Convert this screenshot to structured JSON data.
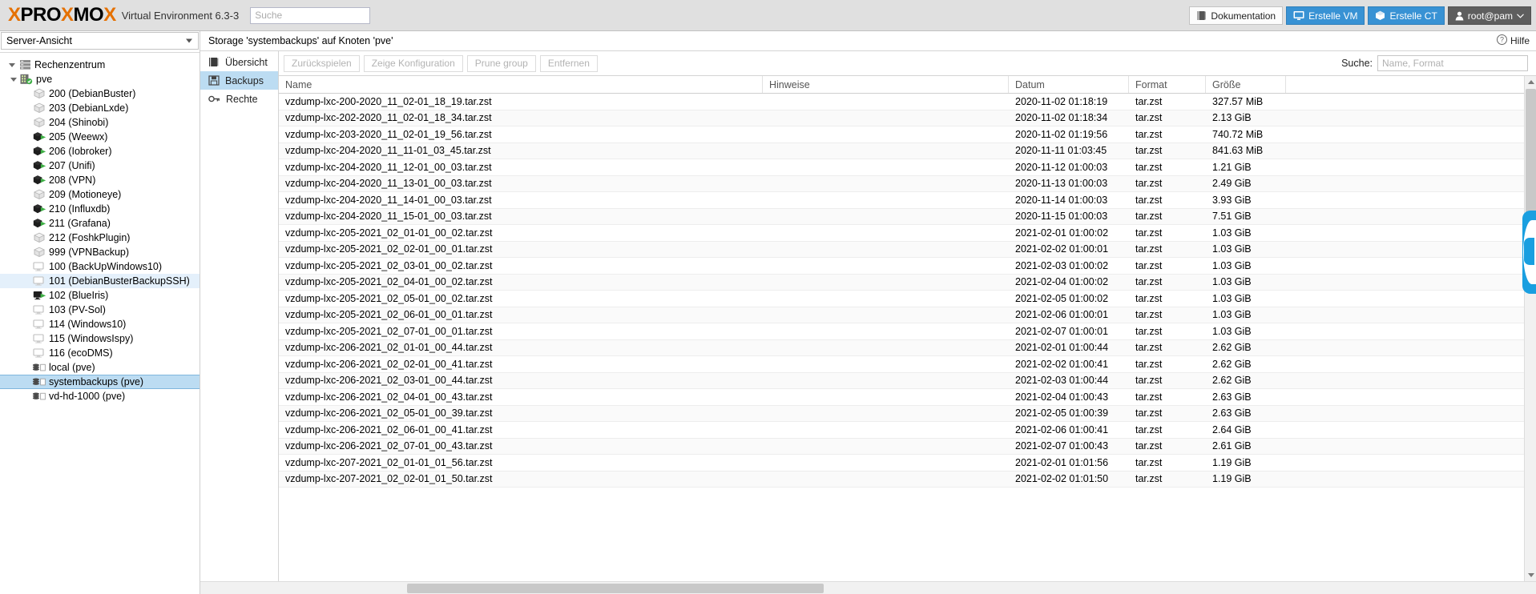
{
  "header": {
    "logo_x1": "X",
    "logo_pro": "PRO",
    "logo_x2": "X",
    "logo_mo": "MO",
    "logo_x3": "X",
    "product": "Virtual Environment 6.3-3",
    "search_placeholder": "Suche",
    "search_value": "",
    "documentation": "Dokumentation",
    "create_vm": "Erstelle VM",
    "create_ct": "Erstelle CT",
    "user": "root@pam"
  },
  "sidebar": {
    "view_selector": "Server-Ansicht",
    "items": [
      {
        "label": "Rechenzentrum",
        "icon": "datacenter-icon",
        "indent": 0,
        "expander": "expanded",
        "state": "none"
      },
      {
        "label": "pve",
        "icon": "node-icon",
        "indent": 1,
        "expander": "expanded",
        "state": "none"
      },
      {
        "label": "200 (DebianBuster)",
        "icon": "lxc-stopped-icon",
        "indent": 2,
        "expander": "none",
        "state": "stopped"
      },
      {
        "label": "203 (DebianLxde)",
        "icon": "lxc-stopped-icon",
        "indent": 2,
        "expander": "none",
        "state": "stopped"
      },
      {
        "label": "204 (Shinobi)",
        "icon": "lxc-stopped-icon",
        "indent": 2,
        "expander": "none",
        "state": "stopped"
      },
      {
        "label": "205 (Weewx)",
        "icon": "lxc-running-icon",
        "indent": 2,
        "expander": "none",
        "state": "running"
      },
      {
        "label": "206 (Iobroker)",
        "icon": "lxc-running-icon",
        "indent": 2,
        "expander": "none",
        "state": "running"
      },
      {
        "label": "207 (Unifi)",
        "icon": "lxc-running-icon",
        "indent": 2,
        "expander": "none",
        "state": "running"
      },
      {
        "label": "208 (VPN)",
        "icon": "lxc-running-icon",
        "indent": 2,
        "expander": "none",
        "state": "running"
      },
      {
        "label": "209 (Motioneye)",
        "icon": "lxc-stopped-icon",
        "indent": 2,
        "expander": "none",
        "state": "stopped"
      },
      {
        "label": "210 (Influxdb)",
        "icon": "lxc-running-icon",
        "indent": 2,
        "expander": "none",
        "state": "running"
      },
      {
        "label": "211 (Grafana)",
        "icon": "lxc-running-icon",
        "indent": 2,
        "expander": "none",
        "state": "running"
      },
      {
        "label": "212 (FoshkPlugin)",
        "icon": "lxc-stopped-icon",
        "indent": 2,
        "expander": "none",
        "state": "stopped"
      },
      {
        "label": "999 (VPNBackup)",
        "icon": "lxc-stopped-icon",
        "indent": 2,
        "expander": "none",
        "state": "stopped"
      },
      {
        "label": "100 (BackUpWindows10)",
        "icon": "qemu-stopped-icon",
        "indent": 2,
        "expander": "none",
        "state": "stopped"
      },
      {
        "label": "101 (DebianBusterBackupSSH)",
        "icon": "qemu-stopped-icon",
        "indent": 2,
        "expander": "none",
        "state": "stopped",
        "highlight": "hover"
      },
      {
        "label": "102 (BlueIris)",
        "icon": "qemu-running-icon",
        "indent": 2,
        "expander": "none",
        "state": "running"
      },
      {
        "label": "103 (PV-Sol)",
        "icon": "qemu-stopped-icon",
        "indent": 2,
        "expander": "none",
        "state": "stopped"
      },
      {
        "label": "114 (Windows10)",
        "icon": "qemu-stopped-icon",
        "indent": 2,
        "expander": "none",
        "state": "stopped"
      },
      {
        "label": "115 (WindowsIspy)",
        "icon": "qemu-stopped-icon",
        "indent": 2,
        "expander": "none",
        "state": "stopped"
      },
      {
        "label": "116 (ecoDMS)",
        "icon": "qemu-stopped-icon",
        "indent": 2,
        "expander": "none",
        "state": "stopped"
      },
      {
        "label": "local (pve)",
        "icon": "storage-icon",
        "indent": 2,
        "expander": "none",
        "state": "none"
      },
      {
        "label": "systembackups (pve)",
        "icon": "storage-icon",
        "indent": 2,
        "expander": "none",
        "state": "none",
        "highlight": "selected"
      },
      {
        "label": "vd-hd-1000 (pve)",
        "icon": "storage-icon",
        "indent": 2,
        "expander": "none",
        "state": "none"
      }
    ]
  },
  "content": {
    "title": "Storage 'systembackups' auf Knoten 'pve'",
    "help_label": "Hilfe",
    "tabs": [
      {
        "label": "Übersicht",
        "icon": "overview-icon",
        "active": false
      },
      {
        "label": "Backups",
        "icon": "floppy-icon",
        "active": true
      },
      {
        "label": "Rechte",
        "icon": "key-icon",
        "active": false
      }
    ],
    "toolbar": {
      "buttons": [
        {
          "label": "Zurückspielen",
          "disabled": true
        },
        {
          "label": "Zeige Konfiguration",
          "disabled": true
        },
        {
          "label": "Prune group",
          "disabled": true
        },
        {
          "label": "Entfernen",
          "disabled": true
        }
      ],
      "search_label": "Suche:",
      "search_placeholder": "Name, Format",
      "search_value": ""
    },
    "grid": {
      "columns": [
        "Name",
        "Hinweise",
        "Datum",
        "Format",
        "Größe"
      ],
      "rows": [
        {
          "name": "vzdump-lxc-200-2020_11_02-01_18_19.tar.zst",
          "note": "",
          "date": "2020-11-02 01:18:19",
          "format": "tar.zst",
          "size": "327.57 MiB"
        },
        {
          "name": "vzdump-lxc-202-2020_11_02-01_18_34.tar.zst",
          "note": "",
          "date": "2020-11-02 01:18:34",
          "format": "tar.zst",
          "size": "2.13 GiB"
        },
        {
          "name": "vzdump-lxc-203-2020_11_02-01_19_56.tar.zst",
          "note": "",
          "date": "2020-11-02 01:19:56",
          "format": "tar.zst",
          "size": "740.72 MiB"
        },
        {
          "name": "vzdump-lxc-204-2020_11_11-01_03_45.tar.zst",
          "note": "",
          "date": "2020-11-11 01:03:45",
          "format": "tar.zst",
          "size": "841.63 MiB"
        },
        {
          "name": "vzdump-lxc-204-2020_11_12-01_00_03.tar.zst",
          "note": "",
          "date": "2020-11-12 01:00:03",
          "format": "tar.zst",
          "size": "1.21 GiB"
        },
        {
          "name": "vzdump-lxc-204-2020_11_13-01_00_03.tar.zst",
          "note": "",
          "date": "2020-11-13 01:00:03",
          "format": "tar.zst",
          "size": "2.49 GiB"
        },
        {
          "name": "vzdump-lxc-204-2020_11_14-01_00_03.tar.zst",
          "note": "",
          "date": "2020-11-14 01:00:03",
          "format": "tar.zst",
          "size": "3.93 GiB"
        },
        {
          "name": "vzdump-lxc-204-2020_11_15-01_00_03.tar.zst",
          "note": "",
          "date": "2020-11-15 01:00:03",
          "format": "tar.zst",
          "size": "7.51 GiB"
        },
        {
          "name": "vzdump-lxc-205-2021_02_01-01_00_02.tar.zst",
          "note": "",
          "date": "2021-02-01 01:00:02",
          "format": "tar.zst",
          "size": "1.03 GiB"
        },
        {
          "name": "vzdump-lxc-205-2021_02_02-01_00_01.tar.zst",
          "note": "",
          "date": "2021-02-02 01:00:01",
          "format": "tar.zst",
          "size": "1.03 GiB"
        },
        {
          "name": "vzdump-lxc-205-2021_02_03-01_00_02.tar.zst",
          "note": "",
          "date": "2021-02-03 01:00:02",
          "format": "tar.zst",
          "size": "1.03 GiB"
        },
        {
          "name": "vzdump-lxc-205-2021_02_04-01_00_02.tar.zst",
          "note": "",
          "date": "2021-02-04 01:00:02",
          "format": "tar.zst",
          "size": "1.03 GiB"
        },
        {
          "name": "vzdump-lxc-205-2021_02_05-01_00_02.tar.zst",
          "note": "",
          "date": "2021-02-05 01:00:02",
          "format": "tar.zst",
          "size": "1.03 GiB"
        },
        {
          "name": "vzdump-lxc-205-2021_02_06-01_00_01.tar.zst",
          "note": "",
          "date": "2021-02-06 01:00:01",
          "format": "tar.zst",
          "size": "1.03 GiB"
        },
        {
          "name": "vzdump-lxc-205-2021_02_07-01_00_01.tar.zst",
          "note": "",
          "date": "2021-02-07 01:00:01",
          "format": "tar.zst",
          "size": "1.03 GiB"
        },
        {
          "name": "vzdump-lxc-206-2021_02_01-01_00_44.tar.zst",
          "note": "",
          "date": "2021-02-01 01:00:44",
          "format": "tar.zst",
          "size": "2.62 GiB"
        },
        {
          "name": "vzdump-lxc-206-2021_02_02-01_00_41.tar.zst",
          "note": "",
          "date": "2021-02-02 01:00:41",
          "format": "tar.zst",
          "size": "2.62 GiB"
        },
        {
          "name": "vzdump-lxc-206-2021_02_03-01_00_44.tar.zst",
          "note": "",
          "date": "2021-02-03 01:00:44",
          "format": "tar.zst",
          "size": "2.62 GiB"
        },
        {
          "name": "vzdump-lxc-206-2021_02_04-01_00_43.tar.zst",
          "note": "",
          "date": "2021-02-04 01:00:43",
          "format": "tar.zst",
          "size": "2.63 GiB"
        },
        {
          "name": "vzdump-lxc-206-2021_02_05-01_00_39.tar.zst",
          "note": "",
          "date": "2021-02-05 01:00:39",
          "format": "tar.zst",
          "size": "2.63 GiB"
        },
        {
          "name": "vzdump-lxc-206-2021_02_06-01_00_41.tar.zst",
          "note": "",
          "date": "2021-02-06 01:00:41",
          "format": "tar.zst",
          "size": "2.64 GiB"
        },
        {
          "name": "vzdump-lxc-206-2021_02_07-01_00_43.tar.zst",
          "note": "",
          "date": "2021-02-07 01:00:43",
          "format": "tar.zst",
          "size": "2.61 GiB"
        },
        {
          "name": "vzdump-lxc-207-2021_02_01-01_01_56.tar.zst",
          "note": "",
          "date": "2021-02-01 01:01:56",
          "format": "tar.zst",
          "size": "1.19 GiB"
        },
        {
          "name": "vzdump-lxc-207-2021_02_02-01_01_50.tar.zst",
          "note": "",
          "date": "2021-02-02 01:01:50",
          "format": "tar.zst",
          "size": "1.19 GiB"
        }
      ]
    }
  },
  "colors": {
    "accent_orange": "#e57000",
    "primary_blue": "#3892d4",
    "selection_blue": "#bcdcf2",
    "running_green": "#3faf46"
  }
}
